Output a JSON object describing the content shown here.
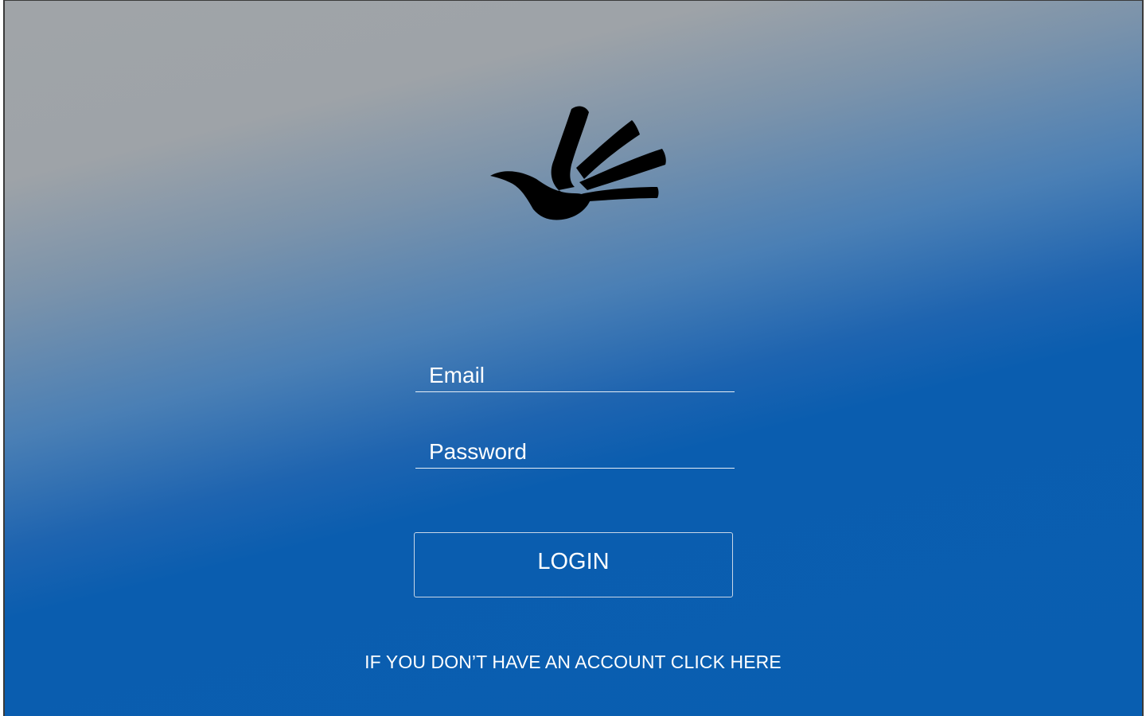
{
  "logo": {
    "icon": "hand-dove-icon",
    "color": "#000000"
  },
  "form": {
    "email": {
      "label": "Email"
    },
    "password": {
      "label": "Password"
    },
    "login_label": "LOGIN"
  },
  "signup": {
    "link_text": "IF YOU DON’T HAVE AN ACCOUNT CLICK HERE"
  },
  "colors": {
    "gradient_top": "#a0a4a8",
    "gradient_bottom": "#095eb0",
    "text": "#ffffff"
  }
}
